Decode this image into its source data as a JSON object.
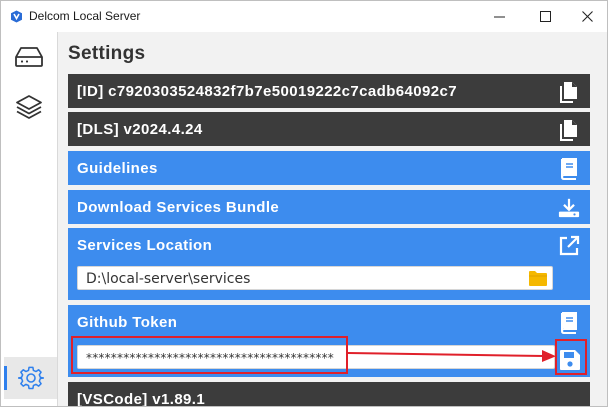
{
  "window": {
    "title": "Delcom Local Server",
    "minimize_glyph": "—",
    "maximize_glyph": "☐",
    "close_glyph": "✕"
  },
  "sidebar": {
    "items": [
      {
        "name": "storage",
        "icon": "drive-icon"
      },
      {
        "name": "layers",
        "icon": "layers-icon"
      },
      {
        "name": "settings",
        "icon": "gear-icon",
        "active": true
      }
    ]
  },
  "settings": {
    "title": "Settings",
    "id_row": {
      "label": "[ID] c7920303524832f7b7e50019222c7cadb64092c7",
      "icon": "copy-icon"
    },
    "dls_row": {
      "label": "[DLS] v2024.4.24",
      "icon": "copy-icon"
    },
    "guidelines_row": {
      "label": "Guidelines",
      "icon": "book-icon"
    },
    "download_row": {
      "label": "Download Services Bundle",
      "icon": "download-icon"
    },
    "services_location": {
      "label": "Services Location",
      "icon": "open-external-icon",
      "value": "D:\\local-server\\services",
      "folder_icon": "folder-icon"
    },
    "github_token": {
      "label": "Github Token",
      "icon": "book-icon",
      "value": "****************************************",
      "save_icon": "save-icon"
    },
    "vscode_row": {
      "label": "[VSCode] v1.89.1"
    }
  },
  "colors": {
    "dark_row": "#3c3c3c",
    "blue_row": "#3d8cee",
    "highlight": "#e0202a",
    "folder": "#f5b800"
  }
}
